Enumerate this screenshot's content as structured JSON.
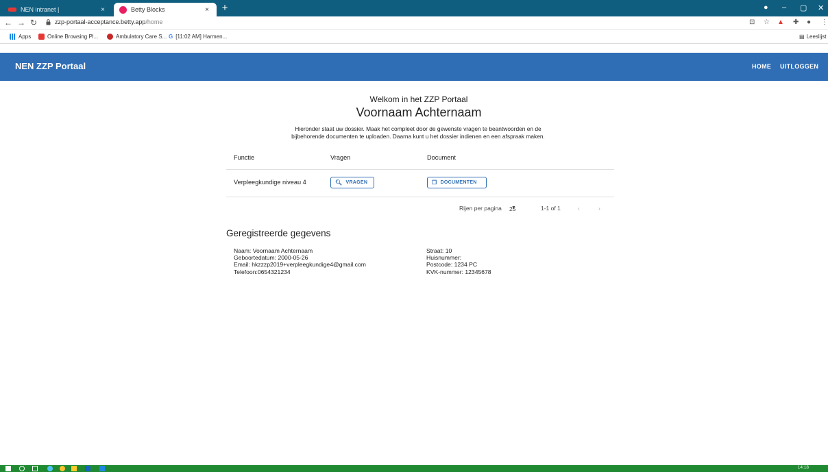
{
  "browser": {
    "tabs": [
      {
        "label": "NEN intranet |",
        "close": "×"
      },
      {
        "label": "Betty Blocks",
        "close": "×"
      }
    ],
    "new_tab": "+",
    "url_host": "zzp-portaal-acceptance.betty.app",
    "url_path": "/home",
    "bookmarks": [
      {
        "label": "Apps"
      },
      {
        "label": "Online Browsing Pl..."
      },
      {
        "label": "Ambulatory Care S..."
      },
      {
        "label": "[11:02 AM] Harmen..."
      }
    ],
    "reading_list": "Leeslijst"
  },
  "app": {
    "brand": "NEN ZZP Portaal",
    "nav": {
      "home": "HOME",
      "logout": "UITLOGGEN"
    },
    "accent": "#2f6eb5"
  },
  "welcome": {
    "subtitle": "Welkom in het ZZP Portaal",
    "name": "Voornaam Achternaam",
    "intro_line1": "Hieronder staat uw dossier. Maak het compleet door de gewenste vragen te beantwoorden en de",
    "intro_line2": "bijbehorende documenten te uploaden. Daarna kunt u het dossier indienen en een afspraak maken."
  },
  "dossier_table": {
    "columns": [
      "Functie",
      "Vragen",
      "Document"
    ],
    "rows": [
      {
        "functie": "Verpleegkundige niveau 4",
        "vragen_button": "VRAGEN",
        "document_button": "DOCUMENTEN"
      }
    ],
    "pagination": {
      "rows_per_page_label": "Rijen per pagina",
      "rows_per_page": "25",
      "range": "1-1 of 1"
    }
  },
  "registered": {
    "title": "Geregistreerde gegevens",
    "left": [
      "Naam: Voornaam Achternaam",
      "Geboortedatum: 2000-05-26",
      "Email: hkzzzp2019+verpleegkundige4@gmail.com",
      "Telefoon:0654321234"
    ],
    "right": [
      "Straat: 10",
      "Huisnummer:",
      "Postcode: 1234 PC",
      "KVK-nummer: 12345678"
    ]
  },
  "taskbar": {
    "time": "14:18"
  }
}
